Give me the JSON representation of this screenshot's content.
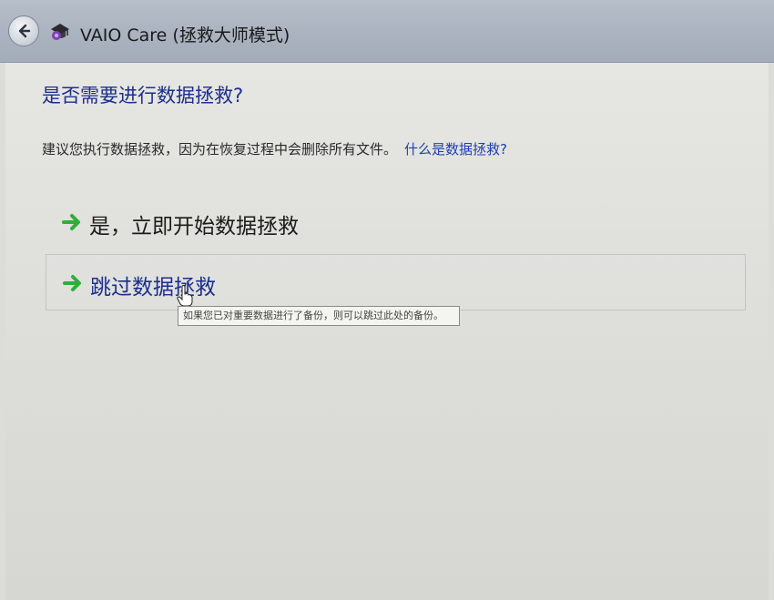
{
  "window": {
    "title": "VAIO Care (拯救大师模式)"
  },
  "icons": {
    "back": "back-arrow-icon",
    "app": "vaio-care-app-icon",
    "option_arrow": "green-arrow-icon",
    "cursor": "hand-cursor-icon"
  },
  "main": {
    "heading": "是否需要进行数据拯救?",
    "description": "建议您执行数据拯救，因为在恢复过程中会删除所有文件。",
    "help_link": "什么是数据拯救?",
    "options": [
      {
        "label": "是，立即开始数据拯救"
      },
      {
        "label": "跳过数据拯救"
      }
    ],
    "tooltip": "如果您已对重要数据进行了备份，则可以跳过此处的备份。"
  },
  "colors": {
    "heading": "#1c2f8c",
    "link": "#1f3fae",
    "arrow": "#2fae3a",
    "titlebar": "#aab3bf",
    "desktop_accent": "#2b55b8"
  }
}
